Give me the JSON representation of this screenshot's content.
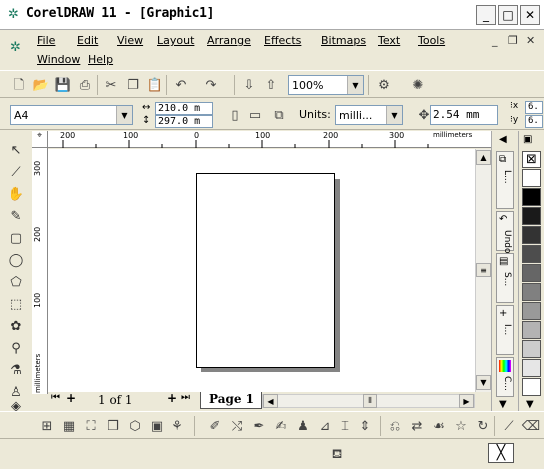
{
  "window": {
    "title": "CorelDRAW 11 - [Graphic1]",
    "app_icon": "coreldraw-balloon-icon"
  },
  "title_controls": {
    "minimize": "_",
    "maximize": "□",
    "close": "✕"
  },
  "menubar": {
    "items": [
      "File",
      "Edit",
      "View",
      "Layout",
      "Arrange",
      "Effects",
      "Bitmaps",
      "Text",
      "Tools",
      "Window",
      "Help"
    ],
    "doc_controls": {
      "minimize": "_",
      "restore": "❐",
      "close": "✕"
    }
  },
  "standard_toolbar": {
    "zoom": "100%",
    "icons": [
      "new-icon",
      "open-icon",
      "save-icon",
      "print-icon",
      "cut-icon",
      "copy-icon",
      "paste-icon",
      "undo-icon",
      "redo-icon",
      "import-icon",
      "export-icon",
      "zoom-dropdown",
      "application-launcher-icon",
      "corel-online-icon"
    ]
  },
  "property_bar": {
    "paper": "A4",
    "width": "210.0 m",
    "height": "297.0 m",
    "units_label": "Units:",
    "units": "milli...",
    "nudge": "2.54 mm",
    "dup_x": "6.",
    "dup_y": "6."
  },
  "rulers": {
    "unit": "millimeters",
    "top_ticks": [
      "200",
      "100",
      "0",
      "100",
      "200",
      "300"
    ],
    "left_ticks": [
      "300",
      "200",
      "100"
    ]
  },
  "page_navigator": {
    "count": "1 of 1",
    "tab": "Page 1"
  },
  "dockers": [
    "L...",
    "Undo",
    "S...",
    "I...",
    "C..."
  ],
  "palette": {
    "colors": [
      "#ffffff",
      "#000000",
      "#1a1a1a",
      "#333333",
      "#4d4d4d",
      "#666666",
      "#808080",
      "#999999",
      "#b3b3b3",
      "#cccccc",
      "#e6e6e6",
      "#ffffff"
    ]
  },
  "accent": {
    "titlebar": "#ffffff",
    "workspace": "#ece9d8",
    "page_shadow": "#848484"
  }
}
